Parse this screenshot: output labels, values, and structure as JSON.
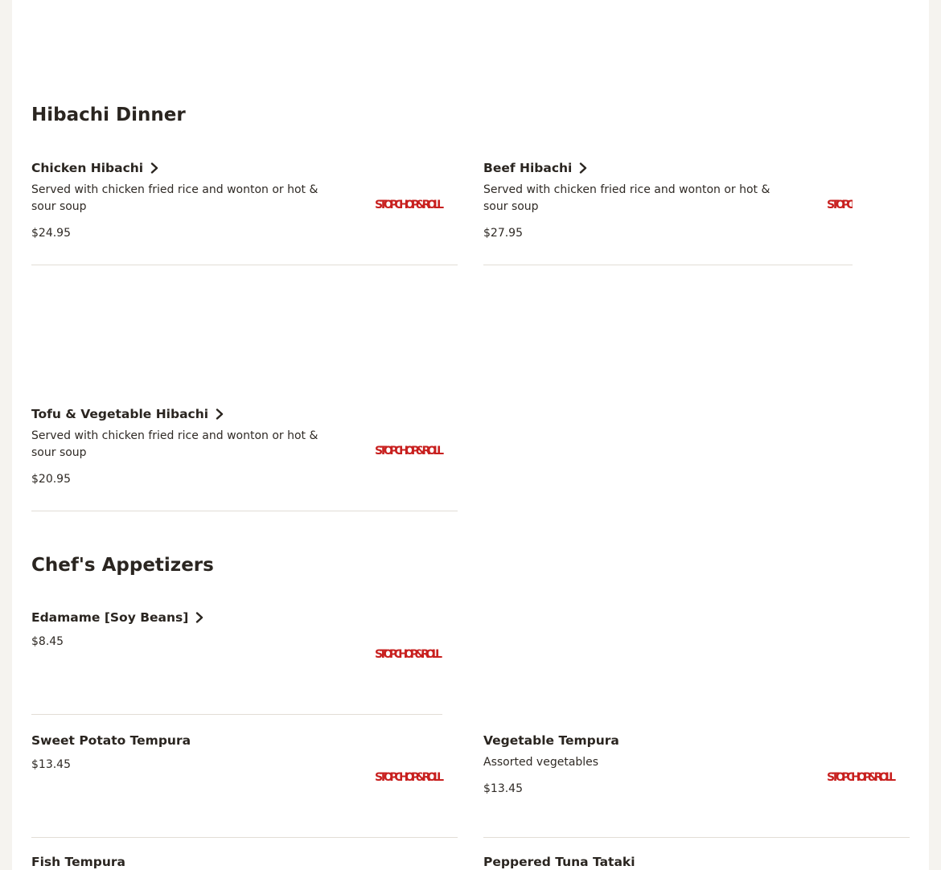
{
  "sections": [
    {
      "title": "Hibachi Dinner",
      "items": [
        {
          "name": "Chicken Hibachi",
          "description": "Served with chicken fried rice and wonton or hot & sour soup",
          "price": "$24.95"
        },
        {
          "name": "Beef Hibachi",
          "description": "Served with chicken fried rice and wonton or hot & sour soup",
          "price": "$27.95"
        },
        {
          "name": "Tofu & Vegetable Hibachi",
          "description": "Served with chicken fried rice and wonton or hot & sour soup",
          "price": "$20.95"
        }
      ]
    },
    {
      "title": "Chef's Appetizers",
      "items": [
        {
          "name": "Edamame [Soy Beans]",
          "price": "$8.45"
        },
        {
          "name": "Sweet Potato Tempura",
          "price": "$13.45"
        },
        {
          "name": "Vegetable Tempura",
          "description": "Assorted vegetables",
          "price": "$13.45"
        },
        {
          "name": "Fish Tempura"
        },
        {
          "name": "Peppered Tuna Tataki"
        }
      ]
    }
  ],
  "logo": {
    "text": "STOP CHOP & ROLL",
    "color": "#c8201f"
  },
  "icons": {
    "chevron": "chevron-right-icon"
  }
}
